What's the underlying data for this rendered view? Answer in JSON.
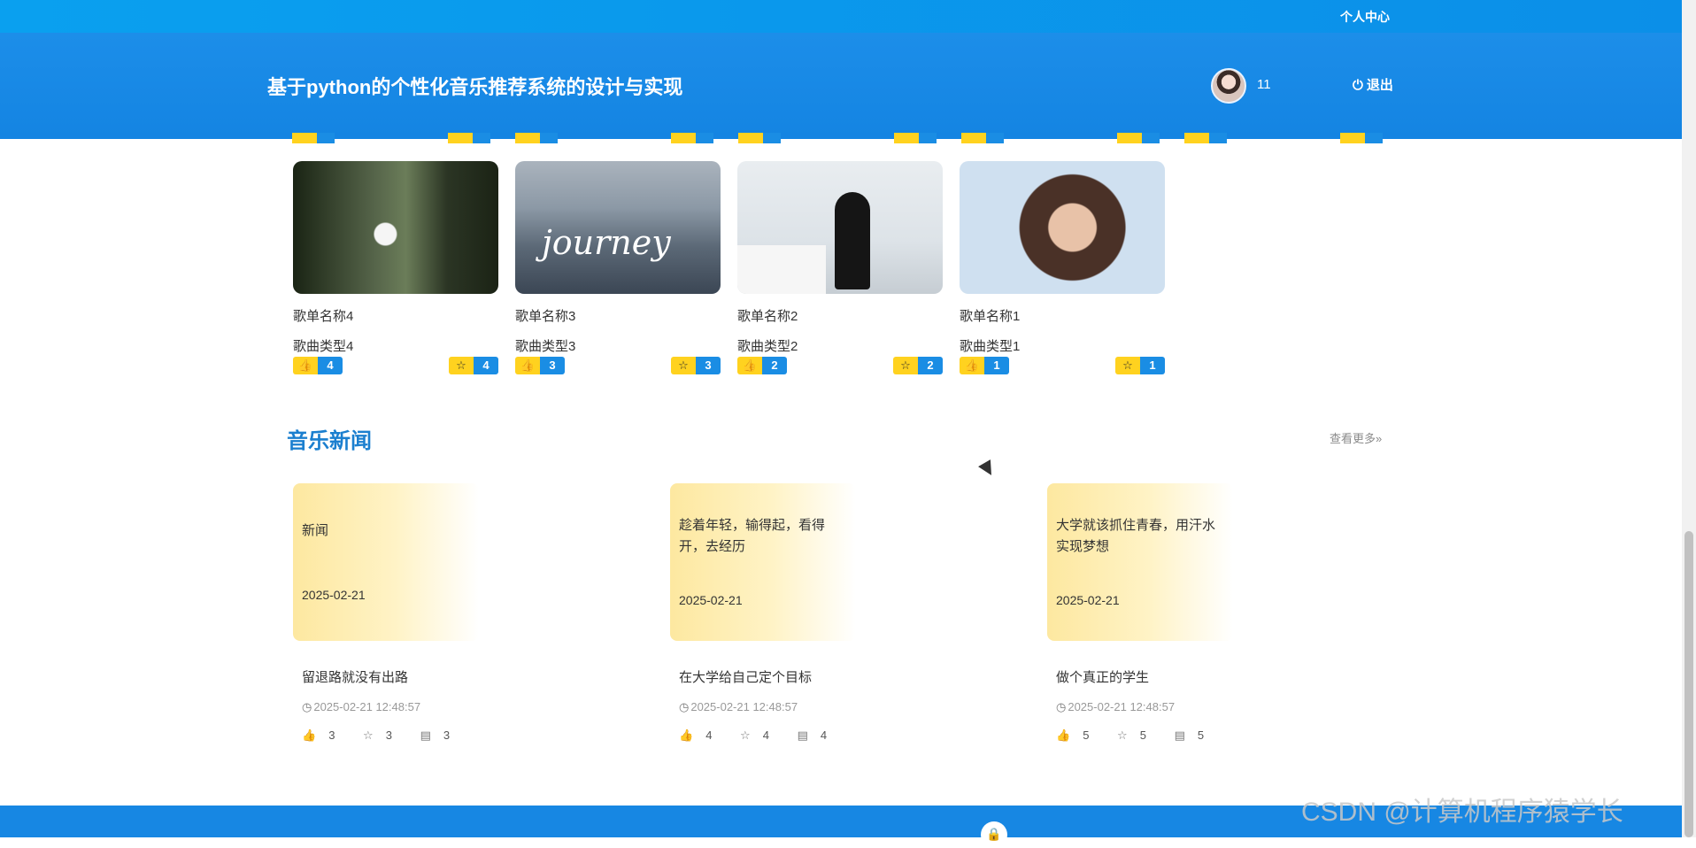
{
  "topbar": {
    "user_center": "个人中心"
  },
  "header": {
    "site_title": "基于python的个性化音乐推荐系统的设计与实现",
    "username": "11",
    "logout_label": "退出"
  },
  "songs": [
    {
      "name": "歌单名称4",
      "type": "歌曲类型4",
      "likes": "4",
      "favorites": "4"
    },
    {
      "name": "歌单名称3",
      "type": "歌曲类型3",
      "likes": "3",
      "favorites": "3",
      "cover_text": "journey"
    },
    {
      "name": "歌单名称2",
      "type": "歌曲类型2",
      "likes": "2",
      "favorites": "2"
    },
    {
      "name": "歌单名称1",
      "type": "歌曲类型1",
      "likes": "1",
      "favorites": "1"
    }
  ],
  "news_section": {
    "title": "音乐新闻",
    "more_label": "查看更多»",
    "items": [
      {
        "thumb_title": "新闻",
        "thumb_date": "2025-02-21",
        "title": "留退路就没有出路",
        "time": "2025-02-21 12:48:57",
        "likes": "3",
        "favorites": "3",
        "comments": "3"
      },
      {
        "thumb_title": "趁着年轻，输得起，看得开，去经历",
        "thumb_date": "2025-02-21",
        "title": "在大学给自己定个目标",
        "time": "2025-02-21 12:48:57",
        "likes": "4",
        "favorites": "4",
        "comments": "4"
      },
      {
        "thumb_title": "大学就该抓住青春，用汗水实现梦想",
        "thumb_date": "2025-02-21",
        "title": "做个真正的学生",
        "time": "2025-02-21 12:48:57",
        "likes": "5",
        "favorites": "5",
        "comments": "5"
      }
    ]
  },
  "watermark": "CSDN @计算机程序猿学长",
  "colors": {
    "primary": "#1484e2",
    "badge_yellow": "#ffd21f",
    "badge_blue": "#1a8de4",
    "section_title": "#1b7fcf"
  }
}
